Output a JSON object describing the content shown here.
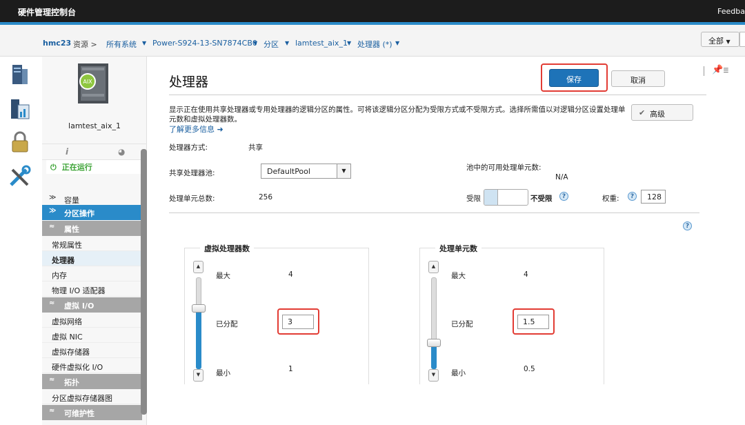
{
  "app": {
    "title": "硬件管理控制台",
    "feedback": "Feedback"
  },
  "breadcrumb": {
    "host": "hmc23",
    "resources": "资源 >",
    "items": [
      "所有系统",
      "Power-S924-13-SN7874CB0",
      "分区",
      "lamtest_aix_1",
      "处理器 (*)"
    ]
  },
  "scope_select": "全部",
  "partition": {
    "badge": "AIX",
    "name": "lamtest_aix_1",
    "status": "正在运行"
  },
  "nav": {
    "capacity": "容量",
    "partition_ops": "分区操作",
    "sections": [
      {
        "title": "属性",
        "items": [
          "常规属性",
          "处理器",
          "内存",
          "物理 I/O 适配器"
        ]
      },
      {
        "title": "虚拟 I/O",
        "items": [
          "虚拟网络",
          "虚拟 NIC",
          "虚拟存储器",
          "硬件虚拟化 I/O"
        ]
      },
      {
        "title": "拓扑",
        "items": [
          "分区虚拟存储器图"
        ]
      },
      {
        "title": "可维护性",
        "items": []
      }
    ],
    "selected": "处理器"
  },
  "page": {
    "title": "处理器",
    "save": "保存",
    "cancel": "取消",
    "description": "显示正在使用共享处理器或专用处理器的逻辑分区的属性。可将该逻辑分区分配为受限方式或不受限方式。选择所需值以对逻辑分区设置处理单元数和虚拟处理器数。",
    "learn_more": "了解更多信息",
    "advanced": "高级",
    "mode_label": "处理器方式:",
    "mode_value": "共享",
    "pool_label": "共享处理器池:",
    "pool_value": "DefaultPool",
    "available_label": "池中的可用处理单元数:",
    "available_value": "N/A",
    "total_label": "处理单元总数:",
    "total_value": "256",
    "capped": "受限",
    "uncapped": "不受限",
    "weight_label": "权重:",
    "weight_value": "128"
  },
  "virtual_processors": {
    "title": "虚拟处理器数",
    "max_label": "最大",
    "max": "4",
    "assigned_label": "已分配",
    "assigned": "3",
    "min_label": "最小",
    "min": "1",
    "level": 0.667
  },
  "processing_units": {
    "title": "处理单元数",
    "max_label": "最大",
    "max": "4",
    "assigned_label": "已分配",
    "assigned": "1.5",
    "min_label": "最小",
    "min": "0.5",
    "level": 0.286
  },
  "colors": {
    "accent": "#2a8bc9",
    "save": "#1e73b8",
    "running": "#3aa233",
    "highlight": "#e23b33"
  }
}
